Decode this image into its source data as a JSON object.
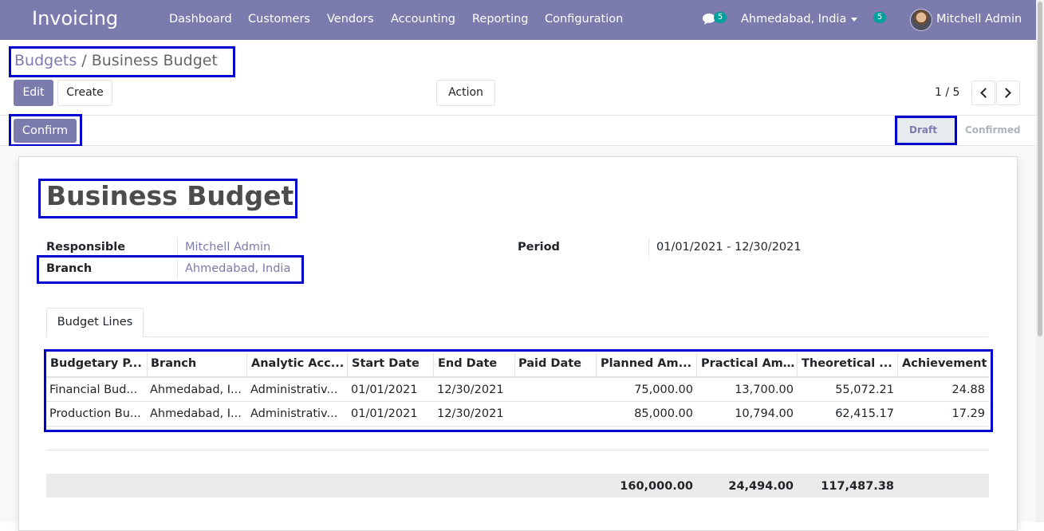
{
  "navbar": {
    "app_name": "Invoicing",
    "menu": [
      "Dashboard",
      "Customers",
      "Vendors",
      "Accounting",
      "Reporting",
      "Configuration"
    ],
    "messages_count": "5",
    "branch": "Ahmedabad, India",
    "activity_count": "5",
    "user": "Mitchell Admin"
  },
  "breadcrumb": {
    "parent": "Budgets",
    "separator": " / ",
    "current": "Business Budget"
  },
  "buttons": {
    "edit": "Edit",
    "create": "Create",
    "action": "Action",
    "confirm": "Confirm"
  },
  "pager": {
    "value": "1 / 5"
  },
  "status": {
    "draft": "Draft",
    "confirmed": "Confirmed",
    "current": "Draft"
  },
  "form": {
    "title": "Business Budget",
    "responsible_label": "Responsible",
    "responsible_value": "Mitchell Admin",
    "branch_label": "Branch",
    "branch_value": "Ahmedabad, India",
    "period_label": "Period",
    "period_value": "01/01/2021 - 12/30/2021"
  },
  "tabs": {
    "budget_lines": "Budget Lines"
  },
  "table": {
    "headers": [
      "Budgetary P...",
      "Branch",
      "Analytic Acc...",
      "Start Date",
      "End Date",
      "Paid Date",
      "Planned Am...",
      "Practical Am...",
      "Theoretical ...",
      "Achievement"
    ],
    "rows": [
      [
        "Financial Bud...",
        "Ahmedabad, I...",
        "Administrativ...",
        "01/01/2021",
        "12/30/2021",
        "",
        "75,000.00",
        "13,700.00",
        "55,072.21",
        "24.88"
      ],
      [
        "Production Bu...",
        "Ahmedabad, I...",
        "Administrativ...",
        "01/01/2021",
        "12/30/2021",
        "",
        "85,000.00",
        "10,794.00",
        "62,415.17",
        "17.29"
      ]
    ],
    "totals": {
      "planned": "160,000.00",
      "practical": "24,494.00",
      "theoretical": "117,487.38"
    }
  },
  "colors": {
    "brand": "#7c7bad",
    "badge": "#00a09d",
    "highlight": "#0000cc"
  }
}
